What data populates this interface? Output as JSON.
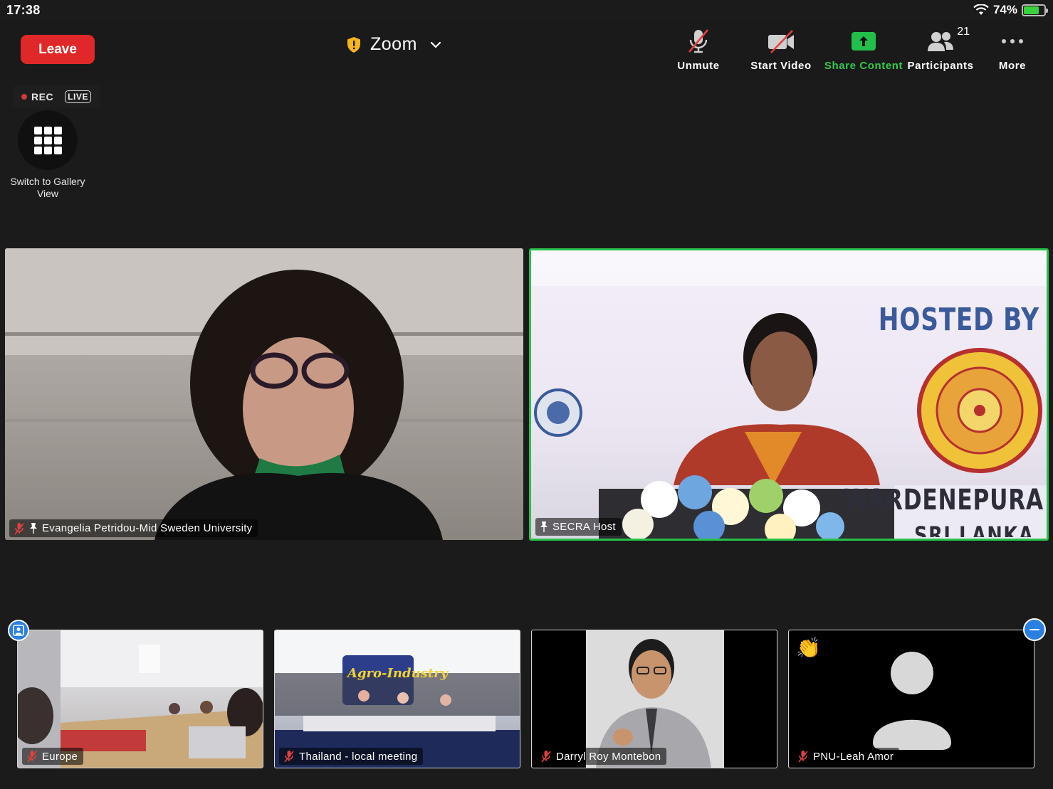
{
  "status": {
    "time": "17:38",
    "battery": "74%",
    "battery_level": 0.74
  },
  "toolbar": {
    "leave_label": "Leave",
    "meeting_title": "Zoom",
    "unmute_label": "Unmute",
    "start_video_label": "Start Video",
    "share_label": "Share Content",
    "participants_label": "Participants",
    "participants_count": "21",
    "more_label": "More"
  },
  "recording": {
    "rec_label": "REC",
    "live_label": "LIVE"
  },
  "gallery": {
    "label": "Switch to Gallery View"
  },
  "main_tiles": [
    {
      "name": "Evangelia Petridou-Mid Sweden University",
      "muted": true,
      "pinned": true
    },
    {
      "name": "SECRA Host",
      "muted": false,
      "pinned": true
    }
  ],
  "stage_text": {
    "hosted_by": "HOSTED BY",
    "banner_bottom": "WARDENEPURA",
    "banner_sub": "SRI LANKA"
  },
  "thumbnails": [
    {
      "name": "Europe"
    },
    {
      "name": "Thailand - local meeting",
      "banner": "Agro-Industry"
    },
    {
      "name": "Darryl Roy Montebon"
    },
    {
      "name": "PNU-Leah Amor",
      "reaction": "👏"
    }
  ],
  "colors": {
    "accent_green": "#27c24a",
    "leave_red": "#e02828",
    "badge_blue": "#2a7fe0"
  }
}
